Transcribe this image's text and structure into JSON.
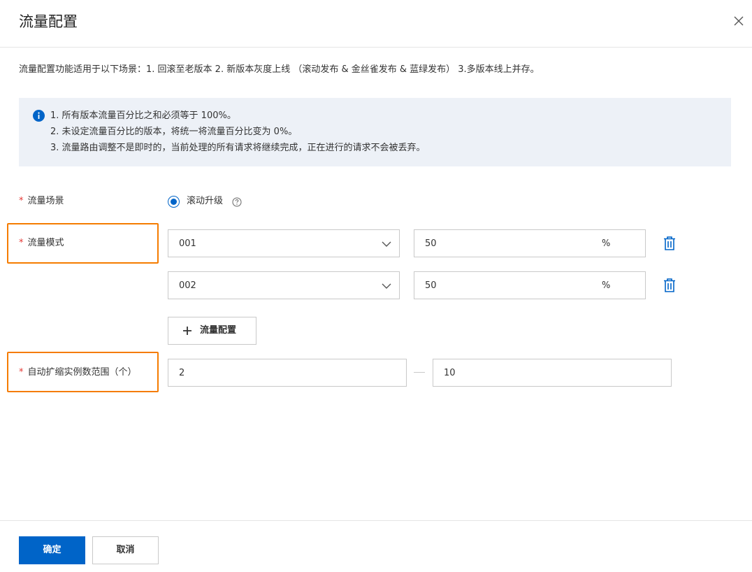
{
  "dialog": {
    "title": "流量配置",
    "close_icon": "close-icon"
  },
  "intro": "流量配置功能适用于以下场景：1. 回滚至老版本 2. 新版本灰度上线 （滚动发布 & 金丝雀发布 & 蓝绿发布） 3.多版本线上并存。",
  "notice": {
    "icon": "info-icon",
    "lines": [
      "1. 所有版本流量百分比之和必须等于 100%。",
      "2. 未设定流量百分比的版本，将统一将流量百分比变为 0%。",
      "3. 流量路由调整不是即时的，当前处理的所有请求将继续完成，正在进行的请求不会被丢弃。"
    ]
  },
  "form": {
    "required_mark": "*",
    "scene": {
      "label": "流量场景",
      "option": "滚动升级",
      "selected": true,
      "help_icon": "help-icon"
    },
    "mode": {
      "label": "流量模式",
      "rows": [
        {
          "version": "001",
          "percent": "50",
          "unit": "%"
        },
        {
          "version": "002",
          "percent": "50",
          "unit": "%"
        }
      ],
      "add_label": "流量配置"
    },
    "scaling": {
      "label": "自动扩缩实例数范围（个）",
      "min": "2",
      "max": "10"
    }
  },
  "footer": {
    "confirm": "确定",
    "cancel": "取消"
  },
  "colors": {
    "primary": "#0064c8",
    "highlight": "#f57c00",
    "required": "#e53935",
    "notice_bg": "#edf1f7"
  }
}
